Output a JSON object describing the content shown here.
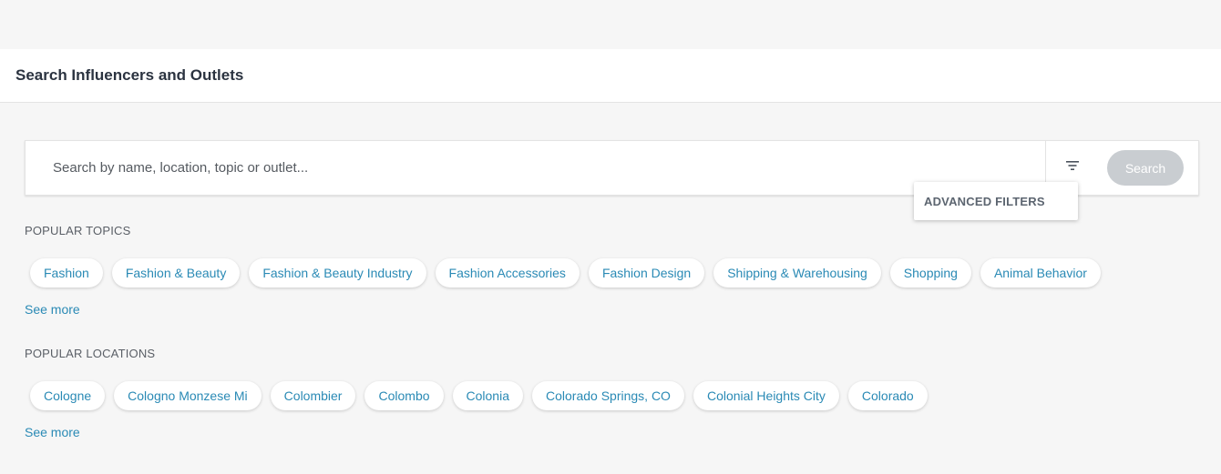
{
  "page": {
    "title": "Search Influencers and Outlets"
  },
  "search": {
    "placeholder": "Search by name, location, topic or outlet...",
    "value": "",
    "button_label": "Search",
    "filter_icon": "filter-icon",
    "tooltip": "ADVANCED FILTERS"
  },
  "topics": {
    "label": "POPULAR TOPICS",
    "items": [
      "Fashion",
      "Fashion & Beauty",
      "Fashion & Beauty Industry",
      "Fashion Accessories",
      "Fashion Design",
      "Shipping & Warehousing",
      "Shopping",
      "Animal Behavior"
    ],
    "see_more": "See more"
  },
  "locations": {
    "label": "POPULAR LOCATIONS",
    "items": [
      "Cologne",
      "Cologno Monzese Mi",
      "Colombier",
      "Colombo",
      "Colonia",
      "Colorado Springs, CO",
      "Colonial Heights City",
      "Colorado"
    ],
    "see_more": "See more"
  },
  "colors": {
    "link": "#2a8ab5",
    "search_button_bg": "#c9cdd1",
    "background": "#f6f6f6"
  }
}
